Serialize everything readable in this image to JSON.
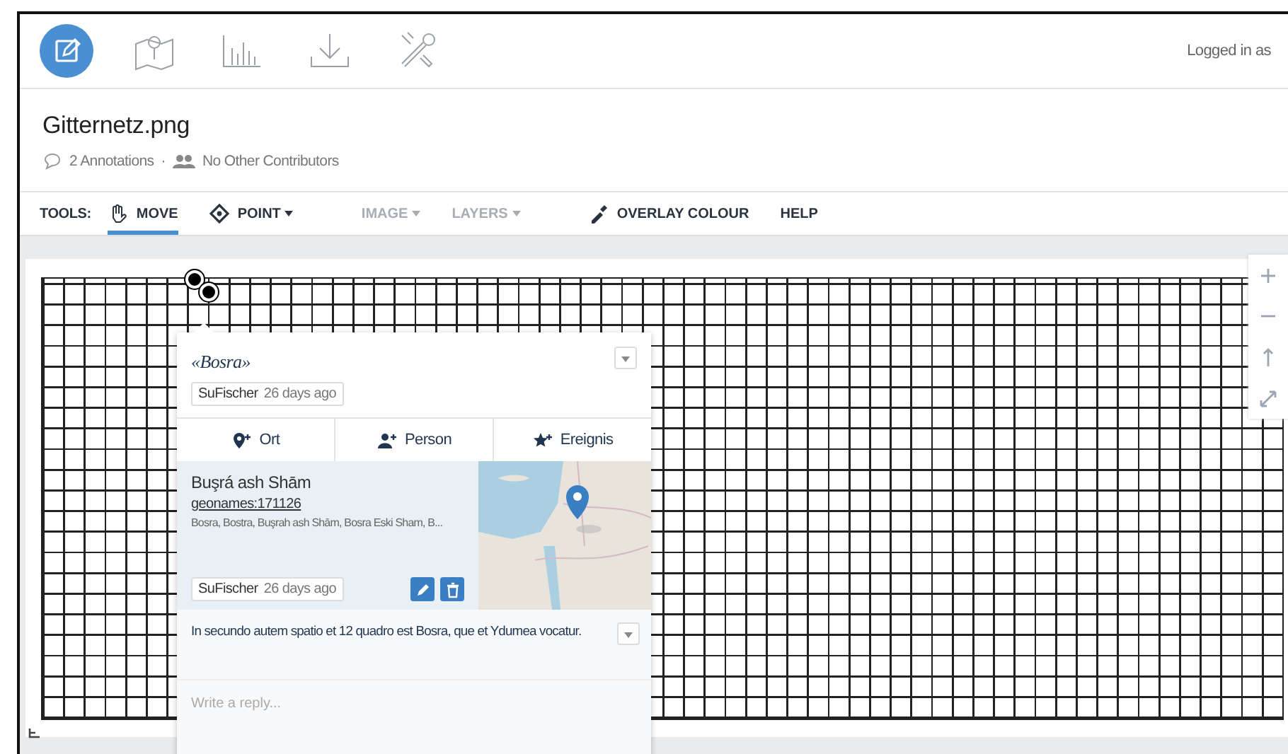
{
  "topbar": {
    "nav": [
      {
        "kind": "edit",
        "selected": true
      },
      {
        "kind": "map",
        "selected": false
      },
      {
        "kind": "chart",
        "selected": false
      },
      {
        "kind": "download",
        "selected": false
      },
      {
        "kind": "tools",
        "selected": false
      }
    ],
    "login": "Logged in as"
  },
  "document": {
    "title": "Gitternetz.png",
    "annotations": "2 Annotations",
    "separator": "·",
    "contributors": "No Other Contributors"
  },
  "toolbar": {
    "label": "TOOLS:",
    "tools": [
      {
        "kind": "hand",
        "label": "MOVE",
        "selected": true,
        "disabled": false,
        "dropdown": false
      },
      {
        "kind": "point",
        "label": "POINT",
        "selected": false,
        "disabled": false,
        "dropdown": true
      },
      {
        "kind": "none",
        "label": "IMAGE",
        "selected": false,
        "disabled": true,
        "dropdown": true
      },
      {
        "kind": "none",
        "label": "LAYERS",
        "selected": false,
        "disabled": true,
        "dropdown": true
      },
      {
        "kind": "dropper",
        "label": "OVERLAY COLOUR",
        "selected": false,
        "disabled": false,
        "dropdown": false
      },
      {
        "kind": "none",
        "label": "HELP",
        "selected": false,
        "disabled": false,
        "dropdown": false
      }
    ]
  },
  "map_controls": [
    {
      "kind": "zoom-in"
    },
    {
      "kind": "zoom-out"
    },
    {
      "kind": "north"
    },
    {
      "kind": "fullscreen"
    }
  ],
  "annotation": {
    "title": "«Bosra»",
    "author": "SuFischer",
    "time": "26 days ago",
    "tag_buttons": [
      {
        "kind": "place",
        "label": "Ort"
      },
      {
        "kind": "person",
        "label": "Person"
      },
      {
        "kind": "event",
        "label": "Ereignis"
      }
    ],
    "entity": {
      "name": "Buşrá ash Shām",
      "link": "geonames:171126",
      "alt_names": "Bosra, Bostra, Buşrah ash Shām, Bosra Eski Sham, B...",
      "author": "SuFischer",
      "time": "26 days ago"
    },
    "comment": "In secundo autem spatio et 12 quadro est Bosra, que et Ydumea vocatur.",
    "reply": {
      "placeholder": "Write a reply..."
    }
  }
}
